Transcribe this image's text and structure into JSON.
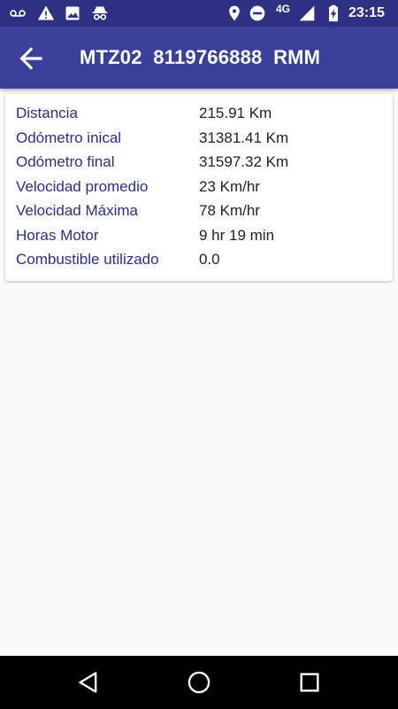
{
  "status_bar": {
    "icons": [
      "voicemail-icon",
      "warning-icon",
      "image-icon",
      "incognito-icon",
      "location-icon",
      "do-not-disturb-icon",
      "signal-icon",
      "battery-charging-icon"
    ],
    "network": "4G",
    "time": "23:15"
  },
  "app_bar": {
    "title": "MTZ02  8119766888  RMM",
    "back_icon": "arrow-back-icon"
  },
  "details": [
    {
      "label": "Distancia",
      "value": "215.91 Km"
    },
    {
      "label": "Odómetro inical",
      "value": "31381.41 Km"
    },
    {
      "label": "Odómetro final",
      "value": "31597.32 Km"
    },
    {
      "label": "Velocidad promedio",
      "value": "23 Km/hr"
    },
    {
      "label": "Velocidad Máxima",
      "value": "78 Km/hr"
    },
    {
      "label": "Horas Motor",
      "value": "9 hr 19 min"
    },
    {
      "label": "Combustible utilizado",
      "value": "0.0"
    }
  ],
  "nav_bar": {
    "icons": [
      "back-triangle-icon",
      "home-circle-icon",
      "recents-square-icon"
    ]
  },
  "colors": {
    "status_bar": "#2e3183",
    "app_bar": "#3a3f99",
    "label": "#2b2e8f",
    "value": "#222222"
  }
}
